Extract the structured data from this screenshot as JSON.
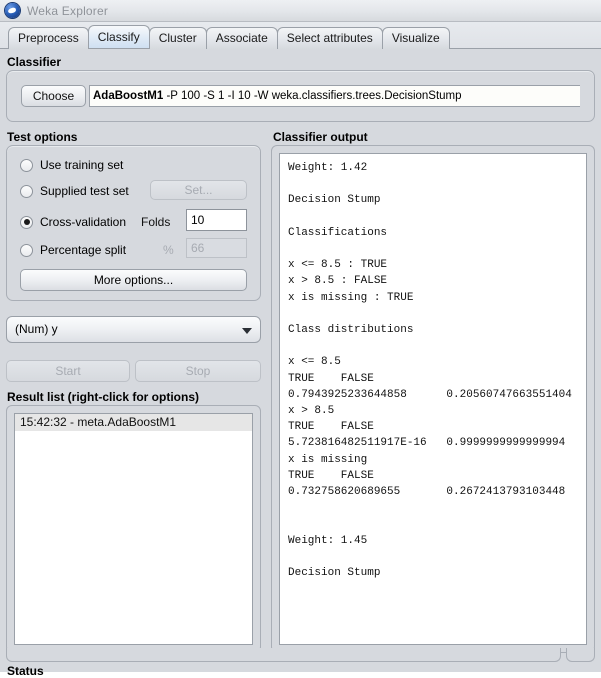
{
  "window": {
    "title": "Weka Explorer",
    "icon": "weka-bird-icon"
  },
  "tabs": [
    {
      "label": "Preprocess",
      "selected": false
    },
    {
      "label": "Classify",
      "selected": true
    },
    {
      "label": "Cluster",
      "selected": false
    },
    {
      "label": "Associate",
      "selected": false
    },
    {
      "label": "Select attributes",
      "selected": false
    },
    {
      "label": "Visualize",
      "selected": false
    }
  ],
  "classifier": {
    "group_label": "Classifier",
    "choose_button": "Choose",
    "name": "AdaBoostM1",
    "options": " -P 100 -S 1 -I 10 -W weka.classifiers.trees.DecisionStump",
    "full_value": "AdaBoostM1 -P 100 -S 1 -I 10 -W weka.classifiers.trees.DecisionStump"
  },
  "test_options": {
    "group_label": "Test options",
    "use_training_set": "Use training set",
    "supplied_test_set": "Supplied test set",
    "set_button": "Set...",
    "cross_validation": "Cross-validation",
    "folds_label": "Folds",
    "folds_value": "10",
    "percentage_split": "Percentage split",
    "percent_symbol": "%",
    "percent_value": "66",
    "more_options": "More options...",
    "selected": "cross-validation"
  },
  "class_selector": {
    "value": "(Num) y"
  },
  "run_buttons": {
    "start": "Start",
    "stop": "Stop"
  },
  "result_list": {
    "label": "Result list (right-click for options)",
    "items": [
      "15:42:32 - meta.AdaBoostM1"
    ]
  },
  "classifier_output": {
    "label": "Classifier output",
    "text": "Weight: 1.42\n\nDecision Stump\n\nClassifications\n\nx <= 8.5 : TRUE\nx > 8.5 : FALSE\nx is missing : TRUE\n\nClass distributions\n\nx <= 8.5\nTRUE    FALSE\n0.7943925233644858      0.20560747663551404\nx > 8.5\nTRUE    FALSE\n5.723816482511917E-16   0.9999999999999994\nx is missing\nTRUE    FALSE\n0.732758620689655       0.2672413793103448\n\n\nWeight: 1.45\n\nDecision Stump\n"
  },
  "status": {
    "label": "Status"
  },
  "colors": {
    "panel_background": "#d6d9de",
    "selected_tab": "#cfe0f2",
    "field_background": "#ffffff",
    "disabled_text": "#a7abb2",
    "title_text": "#8f9399"
  }
}
